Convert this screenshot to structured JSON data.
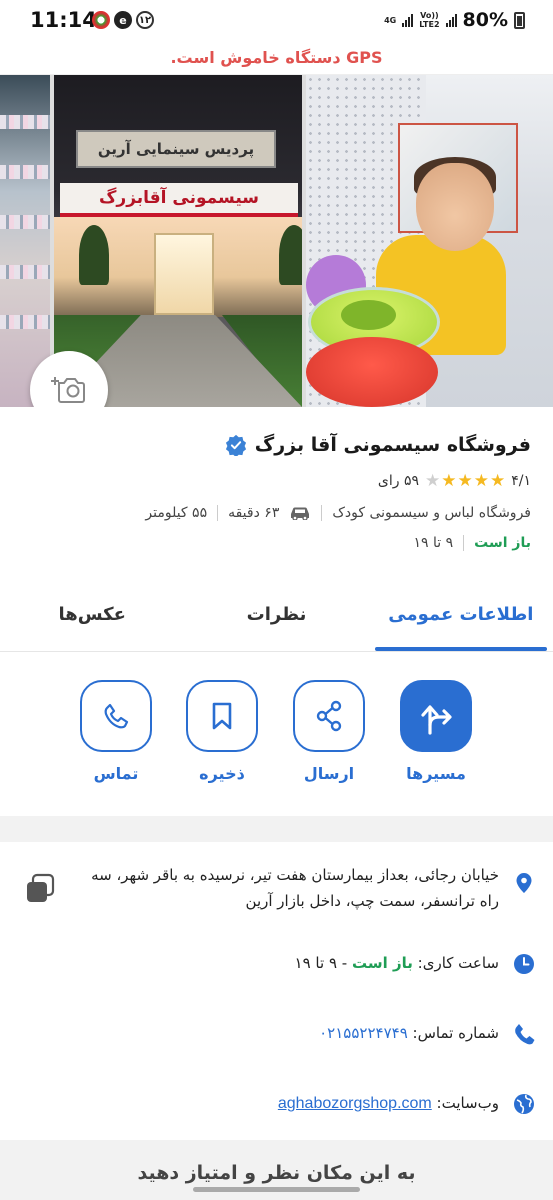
{
  "status_bar": {
    "time": "11:14",
    "notif_count": "۱۲",
    "network_top": "4G",
    "network_vo": "Vo))",
    "network_lte": "LTE2",
    "battery": "80%"
  },
  "gps_banner": "GPS دستگاه خاموش است.",
  "photos": {
    "photo2_top_text": "پردیس سینمایی آرین",
    "photo2_sign_text": "سیسمونی آقابزرگ"
  },
  "place": {
    "title": "فروشگاه سیسمونی آقا بزرگ",
    "rating": "۴/۱",
    "rating_stars": 4,
    "votes": "۵۹ رای",
    "category": "فروشگاه لباس و سیسمونی کودک",
    "drive_time": "۶۳ دقیقه",
    "distance": "۵۵ کیلومتر",
    "open_status": "باز است",
    "hours": "۹ تا ۱۹"
  },
  "tabs": [
    {
      "label": "اطلاعات عمومی",
      "active": true
    },
    {
      "label": "نظرات",
      "active": false
    },
    {
      "label": "عکس‌ها",
      "active": false
    }
  ],
  "actions": {
    "directions": "مسیرها",
    "share": "ارسال",
    "save": "ذخیره",
    "call": "تماس"
  },
  "details": {
    "address": "خیابان رجائی، بعداز بیمارستان هفت تیر، نرسیده به باقر شهر، سه راه ترانسفر، سمت چپ، داخل بازار آرین",
    "hours_label": "ساعت کاری:",
    "hours_open": "باز است",
    "hours_value": "- ۹ تا ۱۹",
    "phone_label": "شماره تماس:",
    "phone_value": "۰۲۱۵۵۲۲۴۷۴۹",
    "website_label": "وب‌سایت:",
    "website_value": "aghabozorgshop.com"
  },
  "bottom_partial": "به این مکان نظر و امتیاز دهید",
  "colors": {
    "accent": "#2a6ed1",
    "open_green": "#1f9d55",
    "gps_red": "#e0524f",
    "star": "#f5b921"
  }
}
